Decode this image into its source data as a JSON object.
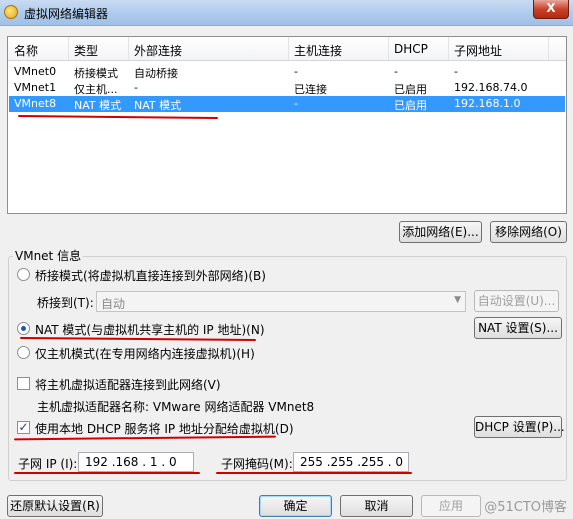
{
  "window": {
    "title": "虚拟网络编辑器",
    "close_label": "X"
  },
  "table": {
    "headers": [
      "名称",
      "类型",
      "外部连接",
      "主机连接",
      "DHCP",
      "子网地址"
    ],
    "rows": [
      {
        "name": "VMnet0",
        "type": "桥接模式",
        "external": "自动桥接",
        "host": "-",
        "dhcp": "-",
        "subnet": "-"
      },
      {
        "name": "VMnet1",
        "type": "仅主机...",
        "external": "-",
        "host": "已连接",
        "dhcp": "已启用",
        "subnet": "192.168.74.0"
      },
      {
        "name": "VMnet8",
        "type": "NAT 模式",
        "external": "NAT 模式",
        "host": "-",
        "dhcp": "已启用",
        "subnet": "192.168.1.0"
      }
    ],
    "selected_row": 2
  },
  "buttons": {
    "add_network": "添加网络(E)...",
    "remove_network": "移除网络(O)",
    "auto_settings": "自动设置(U)...",
    "nat_settings": "NAT 设置(S)...",
    "dhcp_settings": "DHCP 设置(P)...",
    "restore_defaults": "还原默认设置(R)",
    "ok": "确定",
    "cancel": "取消",
    "apply": "应用"
  },
  "vmnet_info": {
    "group_title": "VMnet 信息",
    "bridged_label": "桥接模式(将虚拟机直接连接到外部网络)(B)",
    "bridged_to_label": "桥接到(T):",
    "bridged_to_value": "自动",
    "nat_label": "NAT 模式(与虚拟机共享主机的 IP 地址)(N)",
    "host_only_label": "仅主机模式(在专用网络内连接虚拟机)(H)",
    "selected_mode": "nat",
    "connect_adapter_label": "将主机虚拟适配器连接到此网络(V)",
    "connect_adapter_checked": false,
    "adapter_name_label": "主机虚拟适配器名称: VMware 网络适配器 VMnet8",
    "use_dhcp_label": "使用本地 DHCP 服务将 IP 地址分配给虚拟机(D)",
    "use_dhcp_checked": true,
    "check_mark": "✓"
  },
  "subnet": {
    "ip_label": "子网 IP (I):",
    "ip_value": "192 .168 . 1  . 0",
    "mask_label": "子网掩码(M):",
    "mask_value": "255 .255 .255 . 0"
  },
  "watermark": "@51CTO博客",
  "colors": {
    "selection": "#3399ff",
    "annotation": "#d00000"
  }
}
